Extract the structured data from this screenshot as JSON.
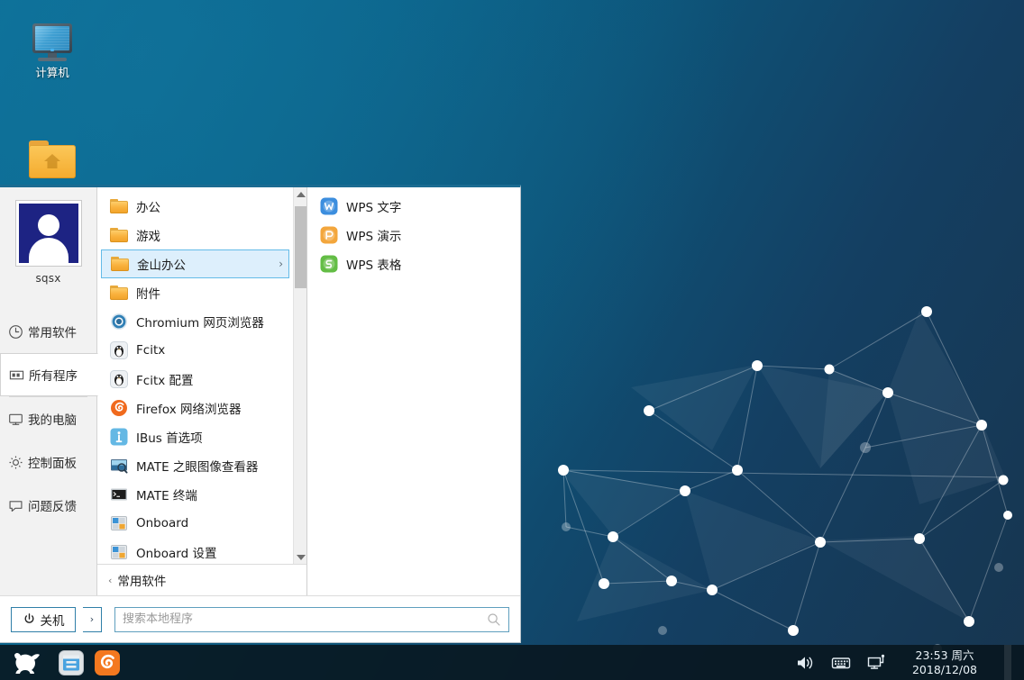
{
  "desktop": {
    "icons": [
      {
        "label": "计算机",
        "icon": "computer-monitor-icon"
      },
      {
        "label": "",
        "icon": "home-folder-icon"
      }
    ]
  },
  "start_menu": {
    "user": {
      "name": "sqsx",
      "avatar": "user-avatar-icon"
    },
    "sidebar": [
      {
        "label": "常用软件",
        "icon": "clock-icon",
        "selected": false
      },
      {
        "label": "所有程序",
        "icon": "grid-icon",
        "selected": true
      },
      {
        "label": "我的电脑",
        "icon": "monitor-icon",
        "selected": false
      },
      {
        "label": "控制面板",
        "icon": "gear-icon",
        "selected": false
      },
      {
        "label": "问题反馈",
        "icon": "feedback-bubble-icon",
        "selected": false
      }
    ],
    "apps": [
      {
        "label": "办公",
        "icon": "folder-icon",
        "type": "folder",
        "active": false,
        "arrow": ""
      },
      {
        "label": "游戏",
        "icon": "folder-icon",
        "type": "folder",
        "active": false,
        "arrow": ""
      },
      {
        "label": "金山办公",
        "icon": "folder-icon",
        "type": "folder",
        "active": true,
        "arrow": "›"
      },
      {
        "label": "附件",
        "icon": "folder-icon",
        "type": "folder",
        "active": false,
        "arrow": ""
      },
      {
        "label": "Chromium 网页浏览器",
        "icon": "chromium-icon",
        "type": "app",
        "active": false,
        "arrow": ""
      },
      {
        "label": "Fcitx",
        "icon": "fcitx-penguin-icon",
        "type": "app",
        "active": false,
        "arrow": ""
      },
      {
        "label": "Fcitx 配置",
        "icon": "fcitx-penguin-icon",
        "type": "app",
        "active": false,
        "arrow": ""
      },
      {
        "label": "Firefox 网络浏览器",
        "icon": "firefox-icon",
        "type": "app",
        "active": false,
        "arrow": ""
      },
      {
        "label": "IBus 首选项",
        "icon": "ibus-info-icon",
        "type": "app",
        "active": false,
        "arrow": ""
      },
      {
        "label": "MATE 之眼图像查看器",
        "icon": "eog-image-viewer-icon",
        "type": "app",
        "active": false,
        "arrow": ""
      },
      {
        "label": "MATE 终端",
        "icon": "terminal-icon",
        "type": "app",
        "active": false,
        "arrow": ""
      },
      {
        "label": "Onboard",
        "icon": "onboard-keyboard-icon",
        "type": "app",
        "active": false,
        "arrow": ""
      },
      {
        "label": "Onboard 设置",
        "icon": "onboard-keyboard-icon",
        "type": "app",
        "active": false,
        "arrow": ""
      }
    ],
    "list_footer": {
      "back_arrow": "‹",
      "label": "常用软件"
    },
    "submenu": [
      {
        "label": "WPS 文字",
        "icon": "wps-writer-icon"
      },
      {
        "label": "WPS 演示",
        "icon": "wps-presentation-icon"
      },
      {
        "label": "WPS 表格",
        "icon": "wps-spreadsheet-icon"
      }
    ],
    "bottom": {
      "shutdown_label": "关机",
      "shutdown_icon": "power-icon",
      "shutdown_more": "›",
      "search_placeholder": "搜索本地程序",
      "search_value": "",
      "search_icon": "search-icon"
    }
  },
  "taskbar": {
    "start_icon": "kylin-fox-logo-icon",
    "launchers": [
      {
        "name": "file-manager-icon"
      },
      {
        "name": "firefox-icon"
      }
    ],
    "tray": [
      {
        "name": "volume-icon"
      },
      {
        "name": "keyboard-icon"
      },
      {
        "name": "network-icon"
      }
    ],
    "clock": {
      "time": "23:53 周六",
      "date": "2018/12/08"
    }
  },
  "colors": {
    "wallpaper_left": "#0a6d96",
    "wallpaper_right": "#17354f",
    "menu_accent": "#1b6b91",
    "highlight_bg": "#ddeffc",
    "highlight_border": "#64bbe8",
    "taskbar_bg": "#08161e"
  }
}
